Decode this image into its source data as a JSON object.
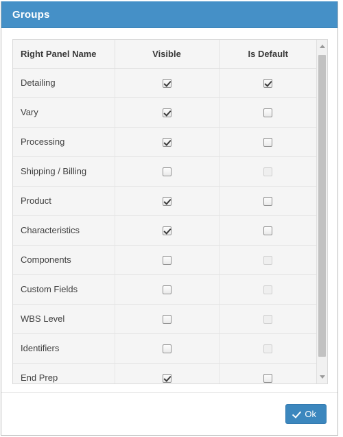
{
  "window": {
    "title": "Groups"
  },
  "table": {
    "columns": [
      {
        "key": "name",
        "label": "Right Panel Name"
      },
      {
        "key": "visible",
        "label": "Visible"
      },
      {
        "key": "is_default",
        "label": "Is Default"
      }
    ],
    "rows": [
      {
        "name": "Detailing",
        "visible": true,
        "visible_enabled": true,
        "is_default": true,
        "is_default_enabled": true
      },
      {
        "name": "Vary",
        "visible": true,
        "visible_enabled": true,
        "is_default": false,
        "is_default_enabled": true
      },
      {
        "name": "Processing",
        "visible": true,
        "visible_enabled": true,
        "is_default": false,
        "is_default_enabled": true
      },
      {
        "name": "Shipping / Billing",
        "visible": false,
        "visible_enabled": true,
        "is_default": false,
        "is_default_enabled": false
      },
      {
        "name": "Product",
        "visible": true,
        "visible_enabled": true,
        "is_default": false,
        "is_default_enabled": true
      },
      {
        "name": "Characteristics",
        "visible": true,
        "visible_enabled": true,
        "is_default": false,
        "is_default_enabled": true
      },
      {
        "name": "Components",
        "visible": false,
        "visible_enabled": true,
        "is_default": false,
        "is_default_enabled": false
      },
      {
        "name": "Custom Fields",
        "visible": false,
        "visible_enabled": true,
        "is_default": false,
        "is_default_enabled": false
      },
      {
        "name": "WBS Level",
        "visible": false,
        "visible_enabled": true,
        "is_default": false,
        "is_default_enabled": false
      },
      {
        "name": "Identifiers",
        "visible": false,
        "visible_enabled": true,
        "is_default": false,
        "is_default_enabled": false
      },
      {
        "name": "End Prep",
        "visible": true,
        "visible_enabled": true,
        "is_default": false,
        "is_default_enabled": true
      }
    ]
  },
  "scrollbar": {
    "up_arrow_icon": "caret-up-icon",
    "down_arrow_icon": "caret-down-icon"
  },
  "footer": {
    "ok_label": "Ok",
    "ok_icon": "check-icon"
  },
  "colors": {
    "header_blue": "#4590c7",
    "button_blue": "#3c87be",
    "grid_bg": "#f5f5f5",
    "grid_border": "#dadada"
  }
}
